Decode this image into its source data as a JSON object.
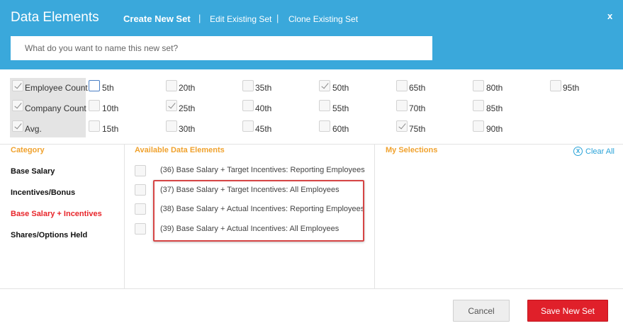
{
  "header": {
    "title": "Data Elements",
    "tabs": [
      {
        "label": "Create New Set",
        "active": true
      },
      {
        "label": "Edit Existing Set",
        "active": false
      },
      {
        "label": "Clone Existing Set",
        "active": false
      }
    ],
    "separator": "|",
    "close_label": "x",
    "name_placeholder": "What do you want to name this new set?",
    "accent_color": "#3aa8db"
  },
  "stats": [
    {
      "label": "Employee Count",
      "checked": true
    },
    {
      "label": "Company Count",
      "checked": true
    },
    {
      "label": "Avg.",
      "checked": true
    }
  ],
  "percentiles": [
    {
      "label": "5th",
      "checked": false
    },
    {
      "label": "20th",
      "checked": false
    },
    {
      "label": "35th",
      "checked": false
    },
    {
      "label": "50th",
      "checked": true
    },
    {
      "label": "65th",
      "checked": false
    },
    {
      "label": "80th",
      "checked": false
    },
    {
      "label": "95th",
      "checked": false
    },
    {
      "label": "10th",
      "checked": false
    },
    {
      "label": "25th",
      "checked": true
    },
    {
      "label": "40th",
      "checked": false
    },
    {
      "label": "55th",
      "checked": false
    },
    {
      "label": "70th",
      "checked": false
    },
    {
      "label": "85th",
      "checked": false
    },
    {
      "label": "15th",
      "checked": false
    },
    {
      "label": "30th",
      "checked": false
    },
    {
      "label": "45th",
      "checked": false
    },
    {
      "label": "60th",
      "checked": false
    },
    {
      "label": "75th",
      "checked": true
    },
    {
      "label": "90th",
      "checked": false
    }
  ],
  "category": {
    "title": "Category",
    "items": [
      {
        "label": "Base Salary",
        "active": false
      },
      {
        "label": "Incentives/Bonus",
        "active": false
      },
      {
        "label": "Base Salary + Incentives",
        "active": true
      },
      {
        "label": "Shares/Options Held",
        "active": false
      }
    ]
  },
  "available": {
    "title": "Available Data Elements",
    "items": [
      {
        "label": "(36) Base Salary + Target Incentives: Reporting Employees",
        "checked": false
      },
      {
        "label": "(37) Base Salary + Target Incentives: All Employees",
        "checked": false
      },
      {
        "label": "(38) Base Salary + Actual Incentives: Reporting Employees",
        "checked": false
      },
      {
        "label": "(39) Base Salary + Actual Incentives: All Employees",
        "checked": false
      }
    ]
  },
  "selections": {
    "title": "My Selections",
    "clear_icon_glyph": "X",
    "clear_label": "Clear All"
  },
  "footer": {
    "cancel_label": "Cancel",
    "save_label": "Save New Set",
    "save_color": "#e0202a"
  }
}
